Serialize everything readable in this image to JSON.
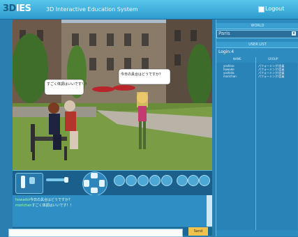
{
  "topbar": {
    "logo": {
      "part_3d": "3D",
      "part_ies": "IES"
    },
    "app_name": "3D Interactive Education System",
    "logout_label": "Logout"
  },
  "scene": {
    "bubbles": [
      {
        "text": "すごく体調はいいです！！"
      },
      {
        "text": "今日の具合はどうですか？"
      }
    ]
  },
  "controls": {
    "icon_labels": [
      "",
      "",
      "",
      "",
      "",
      "",
      ""
    ],
    "group_label": ""
  },
  "chat": {
    "lines": [
      {
        "user": "howadoi",
        "text": "今日の具合はどうですか?"
      },
      {
        "user": "morichan",
        "text": "すごく体調はいいです！！"
      }
    ],
    "input_value": "",
    "send_label": "Send"
  },
  "right_panel": {
    "world_header": "WORLD",
    "world_value": "Paris",
    "userlist_header": "USER LIST",
    "login_label": "Login:4",
    "col_name": "NAME",
    "col_group": "GROUP",
    "users": [
      {
        "name": "yoshino",
        "group": "パフォーミング/会員"
      },
      {
        "name": "howade",
        "group": "パフォーミング/会員"
      },
      {
        "name": "yoshida",
        "group": "パフォーミング/会員"
      },
      {
        "name": "morichan",
        "group": "パフォーミング/会員"
      }
    ]
  },
  "colors": {
    "bar": "#2d9ccf",
    "panel": "#2e8bc0",
    "accent": "#f1c24b"
  }
}
